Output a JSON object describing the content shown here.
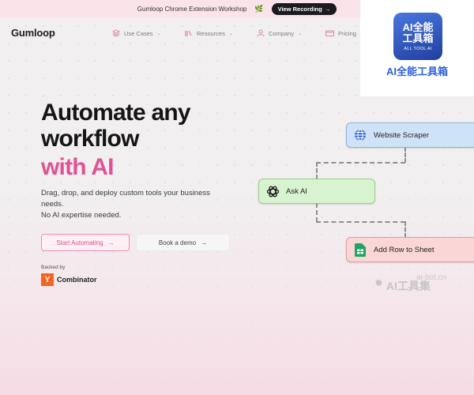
{
  "announcement": {
    "text": "Gumloop Chrome Extension Workshop",
    "emoji": "🌿",
    "cta": "View Recording",
    "cta_arrow": "→"
  },
  "logo": "Gumloop",
  "nav": [
    {
      "label": "Use Cases",
      "icon": "layers-icon"
    },
    {
      "label": "Resources",
      "icon": "book-icon"
    },
    {
      "label": "Company",
      "icon": "user-icon"
    },
    {
      "label": "Pricing",
      "icon": "card-icon"
    }
  ],
  "hero": {
    "line1": "Automate any",
    "line2": "workflow",
    "line3": "with AI"
  },
  "subtitle": {
    "line1": "Drag, drop, and deploy custom tools your business",
    "line2": "needs.",
    "line3": "No AI expertise needed."
  },
  "buttons": {
    "primary": "Start Automating",
    "secondary": "Book a demo",
    "arrow": "→"
  },
  "backed": {
    "label": "Backed by",
    "logo_letter": "Y",
    "name": "Combinator"
  },
  "workflow": {
    "node1": "Website Scraper",
    "node2": "Ask AI",
    "node3": "Add Row to Sheet"
  },
  "badge": {
    "line1": "AI全能",
    "line2": "工具箱",
    "small": "ALL TOOL AI",
    "caption": "AI全能工具箱"
  },
  "watermark": {
    "line1": "ai-bot.cn",
    "line2": "AI工具集"
  },
  "colors": {
    "accent_pink": "#e05293",
    "yc_orange": "#f26522",
    "node_blue": "#cfe3f8",
    "node_green": "#d8f3cf",
    "node_red": "#fad6d6"
  }
}
